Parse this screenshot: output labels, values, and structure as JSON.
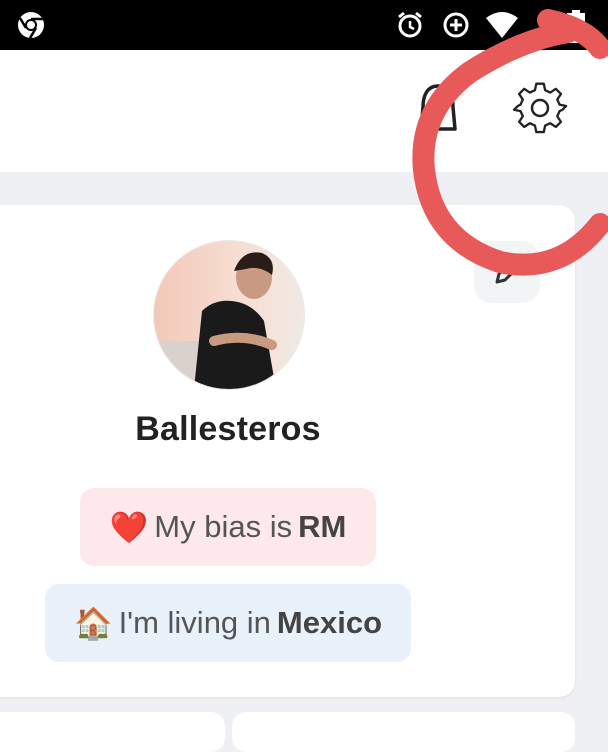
{
  "status_bar": {
    "icons": [
      "chrome-icon",
      "alarm-icon",
      "data-saver-icon",
      "wifi-icon",
      "signal-icon",
      "battery-icon"
    ]
  },
  "header": {
    "icons": [
      "bell-icon",
      "gear-icon"
    ]
  },
  "profile": {
    "name": "Ballesteros",
    "edit_icon": "pencil-icon",
    "bias": {
      "emoji": "❤️",
      "prefix": "My bias is",
      "value": "RM"
    },
    "living": {
      "emoji": "🏠",
      "prefix": "I'm living in",
      "value": "Mexico"
    }
  },
  "colors": {
    "annotation": "#e85a5a",
    "bias_chip_bg": "#fde8ec",
    "living_chip_bg": "#e9f1fb"
  }
}
